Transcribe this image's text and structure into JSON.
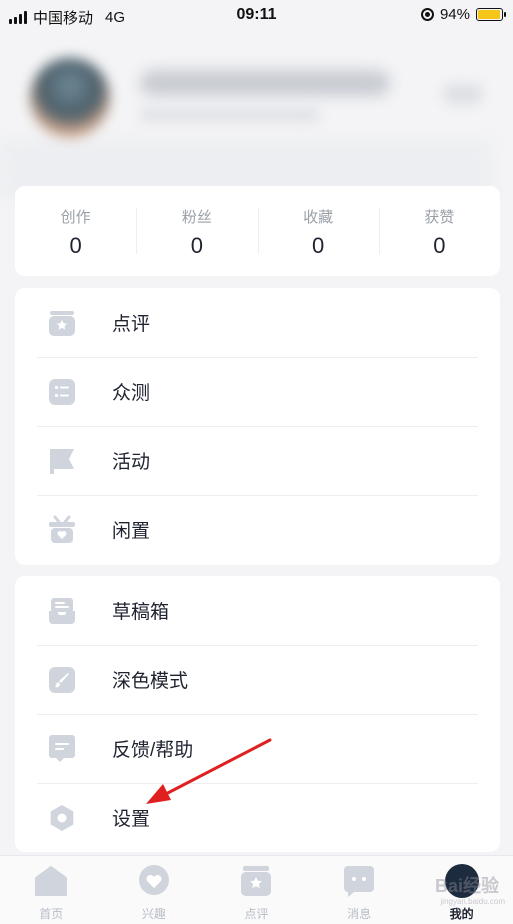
{
  "status_bar": {
    "carrier": "中国移动",
    "network": "4G",
    "time": "09:11",
    "battery": "94%",
    "battery_level": 0.94,
    "battery_color": "#f5c518"
  },
  "stats": [
    {
      "label": "创作",
      "value": "0"
    },
    {
      "label": "粉丝",
      "value": "0"
    },
    {
      "label": "收藏",
      "value": "0"
    },
    {
      "label": "获赞",
      "value": "0"
    }
  ],
  "menu_group_1": [
    {
      "label": "点评",
      "icon": "star-box-icon"
    },
    {
      "label": "众测",
      "icon": "checklist-icon"
    },
    {
      "label": "活动",
      "icon": "flag-icon"
    },
    {
      "label": "闲置",
      "icon": "heart-bag-icon"
    }
  ],
  "menu_group_2": [
    {
      "label": "草稿箱",
      "icon": "draft-box-icon"
    },
    {
      "label": "深色模式",
      "icon": "brush-icon"
    },
    {
      "label": "反馈/帮助",
      "icon": "message-icon"
    },
    {
      "label": "设置",
      "icon": "settings-icon"
    }
  ],
  "tabs": [
    {
      "label": "首页",
      "icon": "home-icon",
      "active": false
    },
    {
      "label": "兴趣",
      "icon": "heart-bubble-icon",
      "active": false
    },
    {
      "label": "点评",
      "icon": "star-box-icon",
      "active": false
    },
    {
      "label": "消息",
      "icon": "chat-icon",
      "active": false
    },
    {
      "label": "我的",
      "icon": "avatar-icon",
      "active": true
    }
  ],
  "watermark": {
    "text": "Bai经验",
    "sub": "jingyan.baidu.com"
  },
  "colors": {
    "icon": "#cfd4dd",
    "text": "#1f2330",
    "muted": "#9aa0a8",
    "arrow": "#e02020"
  }
}
